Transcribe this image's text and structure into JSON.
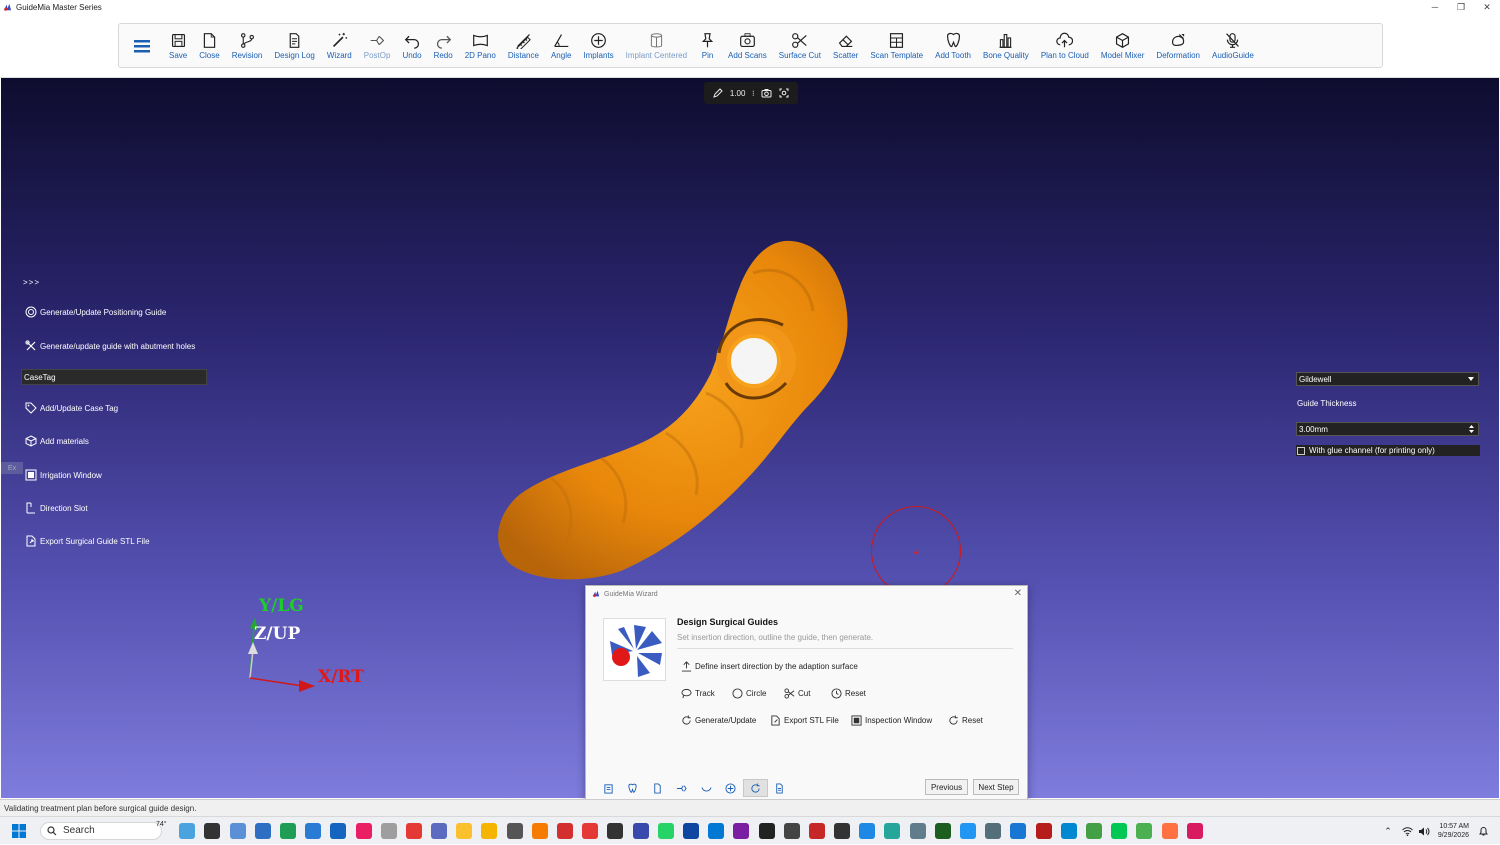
{
  "window": {
    "title": "GuideMia Master Series",
    "minimize": "─",
    "restore": "❐",
    "close": "✕"
  },
  "toolbar": {
    "items": [
      {
        "id": "save",
        "label": "Save",
        "icon": "save-icon"
      },
      {
        "id": "close",
        "label": "Close",
        "icon": "close-file-icon"
      },
      {
        "id": "revision",
        "label": "Revision",
        "icon": "revision-icon"
      },
      {
        "id": "design-log",
        "label": "Design Log",
        "icon": "document-icon"
      },
      {
        "id": "wizard",
        "label": "Wizard",
        "icon": "wand-icon"
      },
      {
        "id": "postop",
        "label": "PostOp",
        "icon": "postop-icon"
      },
      {
        "id": "undo",
        "label": "Undo",
        "icon": "undo-icon"
      },
      {
        "id": "redo",
        "label": "Redo",
        "icon": "redo-icon"
      },
      {
        "id": "2d-pano",
        "label": "2D Pano",
        "icon": "pano-icon"
      },
      {
        "id": "distance",
        "label": "Distance",
        "icon": "ruler-icon"
      },
      {
        "id": "angle",
        "label": "Angle",
        "icon": "angle-icon"
      },
      {
        "id": "implants",
        "label": "Implants",
        "icon": "plus-circle-icon"
      },
      {
        "id": "implant-centered",
        "label": "Implant Centered",
        "icon": "cylinder-icon"
      },
      {
        "id": "pin",
        "label": "Pin",
        "icon": "pin-icon"
      },
      {
        "id": "add-scans",
        "label": "Add Scans",
        "icon": "camera-plus-icon"
      },
      {
        "id": "surface-cut",
        "label": "Surface Cut",
        "icon": "scissors-icon"
      },
      {
        "id": "scatter",
        "label": "Scatter",
        "icon": "eraser-icon"
      },
      {
        "id": "scan-template",
        "label": "Scan Template",
        "icon": "template-icon"
      },
      {
        "id": "add-tooth",
        "label": "Add Tooth",
        "icon": "tooth-icon"
      },
      {
        "id": "bone-quality",
        "label": "Bone Quality",
        "icon": "bar-chart-icon"
      },
      {
        "id": "plan-to-cloud",
        "label": "Plan to Cloud",
        "icon": "cloud-upload-icon"
      },
      {
        "id": "model-mixer",
        "label": "Model Mixer",
        "icon": "cube-icon"
      },
      {
        "id": "deformation",
        "label": "Deformation",
        "icon": "deformation-icon"
      },
      {
        "id": "audioguide",
        "label": "AudioGuide",
        "icon": "mic-off-icon"
      }
    ]
  },
  "view_toolbar": {
    "zoom": "1.00",
    "separator": "⁝"
  },
  "side_panel": {
    "toggle": ">>>",
    "items": [
      {
        "label": "Generate/Update Positioning Guide",
        "icon": "target-icon"
      },
      {
        "label": "Generate/update guide with abutment holes",
        "icon": "tools-icon"
      },
      {
        "label": "Add/Update Case Tag",
        "icon": "tag-icon"
      },
      {
        "label": "Add materials",
        "icon": "box-icon"
      },
      {
        "label": "Irrigation Window",
        "icon": "window-icon"
      },
      {
        "label": "Direction Slot",
        "icon": "slot-icon"
      },
      {
        "label": "Export Surgical Guide STL File",
        "icon": "export-icon"
      }
    ],
    "casetag_value": "CaseTag",
    "collapsed_tab": "Ex"
  },
  "right_panel": {
    "material": "Gildewell",
    "thickness_label": "Guide Thickness",
    "thickness_value": "3.00mm",
    "glue_channel_label": "With glue channel (for printing only)",
    "glue_channel_checked": false
  },
  "axes": {
    "y": "Y/LG",
    "z": "Z/UP",
    "x": "X/RT"
  },
  "wizard": {
    "title": "GuideMia Wizard",
    "close": "✕",
    "heading": "Design Surgical Guides",
    "subtitle": "Set insertion direction, outline the guide, then generate.",
    "define": "Define insert direction by the adaption surface",
    "row1": [
      {
        "label": "Track",
        "icon": "lasso-icon"
      },
      {
        "label": "Circle",
        "icon": "circle-icon"
      },
      {
        "label": "Cut",
        "icon": "scissors-icon"
      },
      {
        "label": "Reset",
        "icon": "reset-icon"
      }
    ],
    "row2": [
      {
        "label": "Generate/Update",
        "icon": "refresh-icon"
      },
      {
        "label": "Export STL File",
        "icon": "export-icon"
      },
      {
        "label": "Inspection Window",
        "icon": "window-icon"
      },
      {
        "label": "Reset",
        "icon": "reset-icon"
      }
    ],
    "previous": "Previous",
    "next": "Next Step"
  },
  "statusbar": {
    "text": "Validating treatment plan before surgical guide design."
  },
  "taskbar": {
    "search": "Search",
    "weather": "74°",
    "time": "10:57 AM",
    "date": "9/29/2026",
    "app_colors": [
      "#4aa3df",
      "#333333",
      "#5b8fd6",
      "#2e6fc4",
      "#1f9d55",
      "#2a7bd4",
      "#1565c0",
      "#e91e63",
      "#9e9e9e",
      "#e53935",
      "#5c6bc0",
      "#fbc02d",
      "#f5b400",
      "#555555",
      "#f57c00",
      "#d32f2f",
      "#e53935",
      "#333333",
      "#3949ab",
      "#25d366",
      "#0d47a1",
      "#0078d4",
      "#7b1fa2",
      "#222222",
      "#444444",
      "#c62828",
      "#333333",
      "#1e88e5",
      "#26a69a",
      "#607d8b",
      "#1b5e20",
      "#2196f3",
      "#546e7a",
      "#1976d2",
      "#b71c1c",
      "#0288d1",
      "#43a047",
      "#00c853",
      "#4caf50",
      "#ff7043",
      "#d81b60"
    ]
  }
}
